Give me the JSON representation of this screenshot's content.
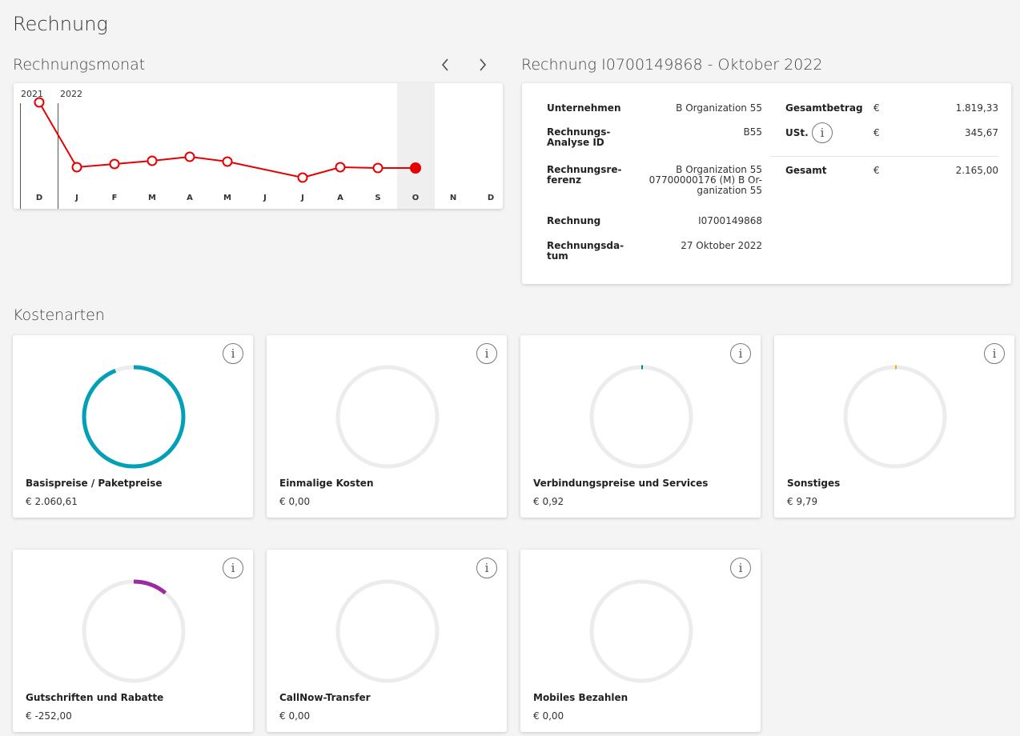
{
  "page": {
    "title": "Rechnung"
  },
  "month_section": {
    "title": "Rechnungsmonat",
    "prev_icon": "chevron-left-icon",
    "next_icon": "chevron-right-icon",
    "years": [
      "2021",
      "2022"
    ],
    "months": [
      "D",
      "J",
      "F",
      "M",
      "A",
      "M",
      "J",
      "J",
      "A",
      "S",
      "O",
      "N",
      "D"
    ],
    "selected_month": "O",
    "accent": "#e60000"
  },
  "invoice": {
    "title": "Rechnung I0700149868 - Oktober 2022",
    "fields": [
      {
        "key": "Unternehmen",
        "value": "B Organization 55"
      },
      {
        "key": "Rechnungs-\nAnalyse ID",
        "value": "B55"
      },
      {
        "key": "Rechnungsre-\nferenz",
        "value": "B Organization 55\n07700000176 (M) B Or-\nganization 55"
      },
      {
        "key": "Rechnung",
        "value": "I0700149868"
      },
      {
        "key": "Rechnungsda-\ntum",
        "value": "27 Oktober 2022"
      }
    ],
    "totals": [
      {
        "key": "Gesamtbetrag",
        "currency": "€",
        "value": "1.819,33"
      },
      {
        "key": "USt.",
        "currency": "€",
        "value": "345,67"
      },
      {
        "key": "Gesamt",
        "currency": "€",
        "value": "2.165,00"
      }
    ],
    "info_glyph": "i"
  },
  "costs": {
    "title": "Kostenarten",
    "info_glyph": "i",
    "cards": [
      {
        "label": "Basispreise / Paketpreise",
        "value": "€ 2.060,61",
        "color": "#00a0b8",
        "fraction": 0.94,
        "start": 0
      },
      {
        "label": "Einmalige Kosten",
        "value": "€ 0,00",
        "color": "#00a0b8",
        "fraction": 0,
        "start": 0
      },
      {
        "label": "Verbindungspreise und Services",
        "value": "€ 0,92",
        "color": "#007c92",
        "fraction": 0.004,
        "start": 0
      },
      {
        "label": "Sonstiges",
        "value": "€ 9,79",
        "color": "#f5a623",
        "fraction": 0.004,
        "start": 0
      },
      {
        "label": "Gutschriften und Rabatte",
        "value": "€ -252,00",
        "color": "#9c2aa0",
        "fraction": 0.11,
        "start": 0
      },
      {
        "label": "CallNow-Transfer",
        "value": "€ 0,00",
        "color": "#00a0b8",
        "fraction": 0,
        "start": 0
      },
      {
        "label": "Mobiles Bezahlen",
        "value": "€ 0,00",
        "color": "#00a0b8",
        "fraction": 0,
        "start": 0
      }
    ]
  }
}
